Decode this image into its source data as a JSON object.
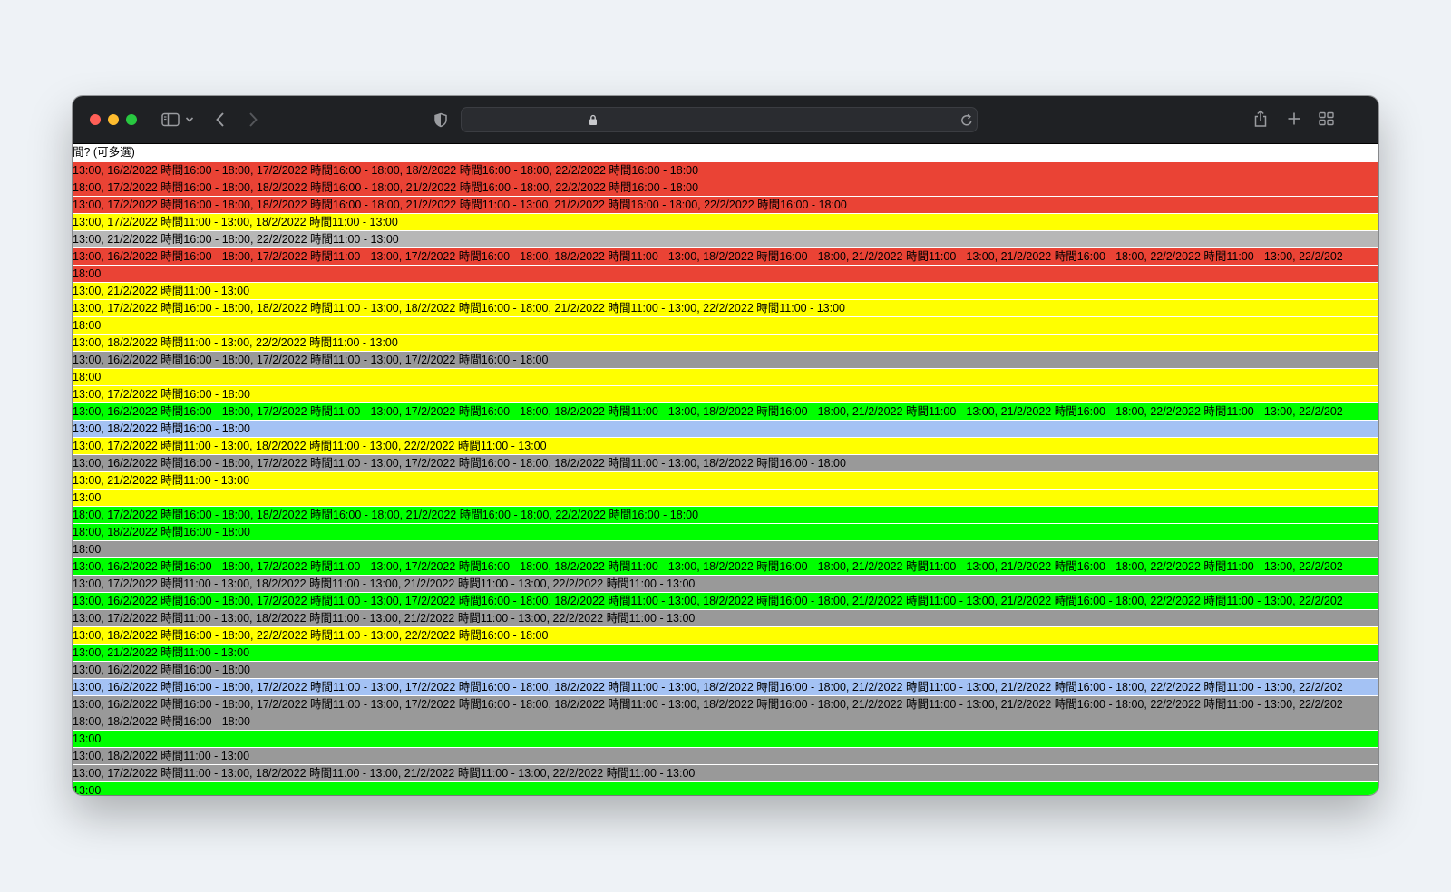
{
  "browser": {
    "address_text": "",
    "icons": {
      "sidebar": "sidebar-icon",
      "chevron": "chevron-down-icon",
      "back": "back-arrow-icon",
      "forward": "forward-arrow-icon",
      "shield": "privacy-shield-icon",
      "lock": "lock-icon",
      "reload": "reload-icon",
      "share": "share-icon",
      "new_tab": "plus-icon",
      "tabs": "tab-overview-icon"
    },
    "traffic_colors": [
      "#ff5f57",
      "#febc2e",
      "#28c840"
    ]
  },
  "sheet": {
    "header": "間? (可多選)",
    "rows": [
      {
        "color": "#ea4335",
        "text": "13:00, 16/2/2022  時間16:00 - 18:00, 17/2/2022  時間16:00 - 18:00, 18/2/2022  時間16:00 - 18:00, 22/2/2022  時間16:00 - 18:00"
      },
      {
        "color": "#ea4335",
        "text": "18:00, 17/2/2022  時間16:00 - 18:00, 18/2/2022  時間16:00 - 18:00, 21/2/2022  時間16:00 - 18:00, 22/2/2022  時間16:00 - 18:00"
      },
      {
        "color": "#ea4335",
        "text": "13:00, 17/2/2022  時間16:00 - 18:00, 18/2/2022  時間16:00 - 18:00, 21/2/2022  時間11:00 - 13:00, 21/2/2022  時間16:00 - 18:00, 22/2/2022  時間16:00 - 18:00"
      },
      {
        "color": "#ffff00",
        "text": "13:00, 17/2/2022  時間11:00 - 13:00, 18/2/2022  時間11:00 - 13:00"
      },
      {
        "color": "#b7b7b7",
        "text": "13:00, 21/2/2022  時間16:00 - 18:00, 22/2/2022  時間11:00 - 13:00"
      },
      {
        "color": "#ea4335",
        "text": "13:00, 16/2/2022  時間16:00 - 18:00, 17/2/2022  時間11:00 - 13:00, 17/2/2022  時間16:00 - 18:00, 18/2/2022  時間11:00 - 13:00, 18/2/2022  時間16:00 - 18:00, 21/2/2022  時間11:00 - 13:00, 21/2/2022  時間16:00 - 18:00, 22/2/2022  時間11:00 - 13:00, 22/2/202"
      },
      {
        "color": "#ea4335",
        "text": "18:00"
      },
      {
        "color": "#ffff00",
        "text": "13:00, 21/2/2022  時間11:00 - 13:00"
      },
      {
        "color": "#ffff00",
        "text": "13:00, 17/2/2022  時間16:00 - 18:00, 18/2/2022  時間11:00 - 13:00, 18/2/2022  時間16:00 - 18:00, 21/2/2022  時間11:00 - 13:00, 22/2/2022  時間11:00 - 13:00"
      },
      {
        "color": "#ffff00",
        "text": "18:00"
      },
      {
        "color": "#ffff00",
        "text": "13:00, 18/2/2022  時間11:00 - 13:00, 22/2/2022  時間11:00 - 13:00"
      },
      {
        "color": "#999999",
        "text": "13:00, 16/2/2022  時間16:00 - 18:00, 17/2/2022  時間11:00 - 13:00, 17/2/2022  時間16:00 - 18:00"
      },
      {
        "color": "#ffff00",
        "text": "18:00"
      },
      {
        "color": "#ffff00",
        "text": "13:00, 17/2/2022  時間16:00 - 18:00"
      },
      {
        "color": "#00ff00",
        "text": "13:00, 16/2/2022  時間16:00 - 18:00, 17/2/2022  時間11:00 - 13:00, 17/2/2022  時間16:00 - 18:00, 18/2/2022  時間11:00 - 13:00, 18/2/2022  時間16:00 - 18:00, 21/2/2022  時間11:00 - 13:00, 21/2/2022  時間16:00 - 18:00, 22/2/2022  時間11:00 - 13:00, 22/2/202"
      },
      {
        "color": "#a4c2f4",
        "text": "13:00, 18/2/2022  時間16:00 - 18:00"
      },
      {
        "color": "#ffff00",
        "text": "13:00, 17/2/2022  時間11:00 - 13:00, 18/2/2022  時間11:00 - 13:00, 22/2/2022  時間11:00 - 13:00"
      },
      {
        "color": "#999999",
        "text": "13:00, 16/2/2022  時間16:00 - 18:00, 17/2/2022  時間11:00 - 13:00, 17/2/2022  時間16:00 - 18:00, 18/2/2022  時間11:00 - 13:00, 18/2/2022  時間16:00 - 18:00"
      },
      {
        "color": "#ffff00",
        "text": "13:00, 21/2/2022  時間11:00 - 13:00"
      },
      {
        "color": "#ffff00",
        "text": "13:00"
      },
      {
        "color": "#00ff00",
        "text": "18:00, 17/2/2022  時間16:00 - 18:00, 18/2/2022  時間16:00 - 18:00, 21/2/2022  時間16:00 - 18:00, 22/2/2022  時間16:00 - 18:00"
      },
      {
        "color": "#00ff00",
        "text": "18:00, 18/2/2022  時間16:00 - 18:00"
      },
      {
        "color": "#999999",
        "text": "18:00"
      },
      {
        "color": "#00ff00",
        "text": "13:00, 16/2/2022  時間16:00 - 18:00, 17/2/2022  時間11:00 - 13:00, 17/2/2022  時間16:00 - 18:00, 18/2/2022  時間11:00 - 13:00, 18/2/2022  時間16:00 - 18:00, 21/2/2022  時間11:00 - 13:00, 21/2/2022  時間16:00 - 18:00, 22/2/2022  時間11:00 - 13:00, 22/2/202"
      },
      {
        "color": "#999999",
        "text": "13:00, 17/2/2022  時間11:00 - 13:00, 18/2/2022  時間11:00 - 13:00, 21/2/2022  時間11:00 - 13:00, 22/2/2022  時間11:00 - 13:00"
      },
      {
        "color": "#00ff00",
        "text": "13:00, 16/2/2022  時間16:00 - 18:00, 17/2/2022  時間11:00 - 13:00, 17/2/2022  時間16:00 - 18:00, 18/2/2022  時間11:00 - 13:00, 18/2/2022  時間16:00 - 18:00, 21/2/2022  時間11:00 - 13:00, 21/2/2022  時間16:00 - 18:00, 22/2/2022  時間11:00 - 13:00, 22/2/202"
      },
      {
        "color": "#999999",
        "text": "13:00, 17/2/2022  時間11:00 - 13:00, 18/2/2022  時間11:00 - 13:00, 21/2/2022  時間11:00 - 13:00, 22/2/2022  時間11:00 - 13:00"
      },
      {
        "color": "#ffff00",
        "text": "13:00, 18/2/2022  時間16:00 - 18:00, 22/2/2022  時間11:00 - 13:00, 22/2/2022  時間16:00 - 18:00"
      },
      {
        "color": "#00ff00",
        "text": "13:00, 21/2/2022  時間11:00 - 13:00"
      },
      {
        "color": "#999999",
        "text": "13:00, 16/2/2022  時間16:00 - 18:00"
      },
      {
        "color": "#a4c2f4",
        "text": "13:00, 16/2/2022  時間16:00 - 18:00, 17/2/2022  時間11:00 - 13:00, 17/2/2022  時間16:00 - 18:00, 18/2/2022  時間11:00 - 13:00, 18/2/2022  時間16:00 - 18:00, 21/2/2022  時間11:00 - 13:00, 21/2/2022  時間16:00 - 18:00, 22/2/2022  時間11:00 - 13:00, 22/2/202"
      },
      {
        "color": "#999999",
        "text": "13:00, 16/2/2022  時間16:00 - 18:00, 17/2/2022  時間11:00 - 13:00, 17/2/2022  時間16:00 - 18:00, 18/2/2022  時間11:00 - 13:00, 18/2/2022  時間16:00 - 18:00, 21/2/2022  時間11:00 - 13:00, 21/2/2022  時間16:00 - 18:00, 22/2/2022  時間11:00 - 13:00, 22/2/202"
      },
      {
        "color": "#999999",
        "text": "18:00, 18/2/2022  時間16:00 - 18:00"
      },
      {
        "color": "#00ff00",
        "text": "13:00"
      },
      {
        "color": "#999999",
        "text": "13:00, 18/2/2022  時間11:00 - 13:00"
      },
      {
        "color": "#999999",
        "text": "13:00, 17/2/2022  時間11:00 - 13:00, 18/2/2022  時間11:00 - 13:00, 21/2/2022  時間11:00 - 13:00, 22/2/2022  時間11:00 - 13:00"
      },
      {
        "color": "#00ff00",
        "text": "13:00"
      }
    ]
  }
}
